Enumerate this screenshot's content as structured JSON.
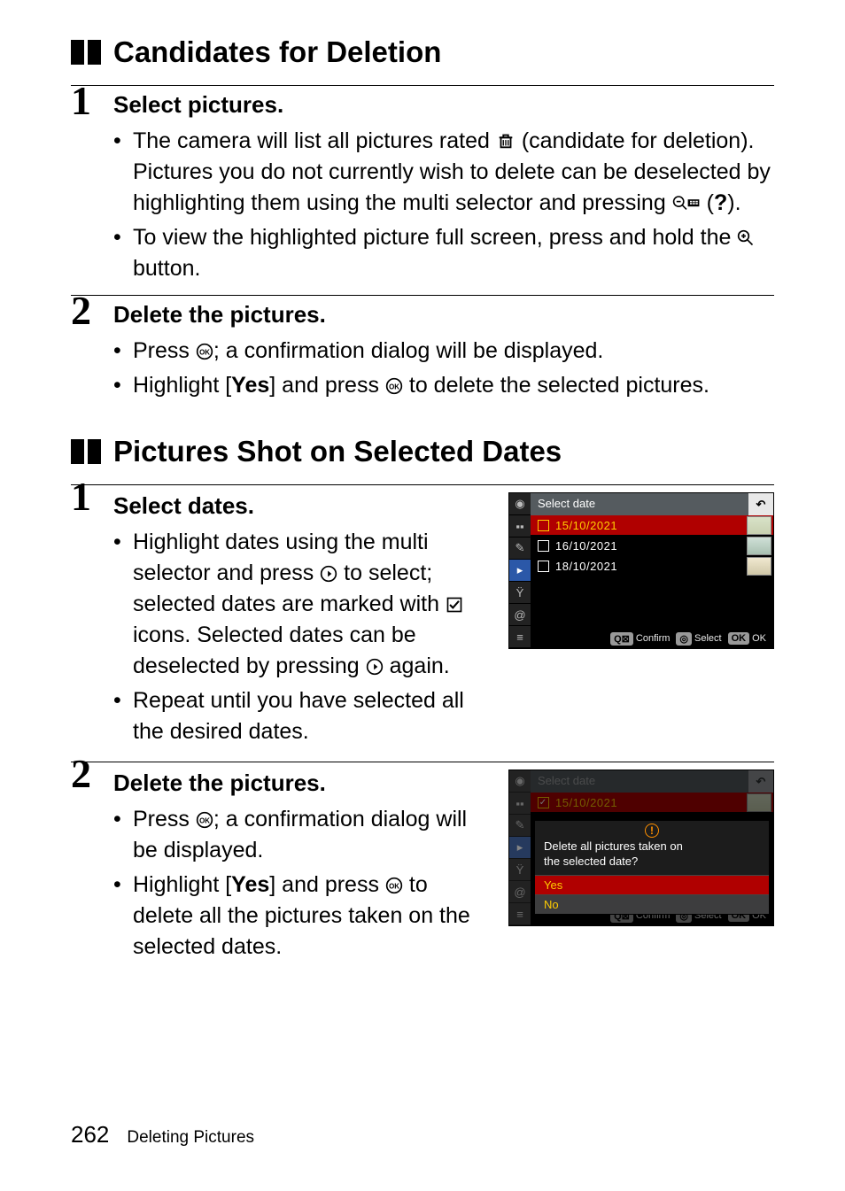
{
  "sectionA": {
    "title": "Candidates for Deletion",
    "steps": [
      {
        "num": "1",
        "title": "Select pictures.",
        "bullets": [
          {
            "parts": [
              "The camera will list all pictures rated ",
              {
                "icon": "trash-candidate"
              },
              " (candidate for deletion). Pictures you do not currently wish to delete can be deselected by highlighting them using the multi selector and pressing ",
              {
                "icon": "qminus"
              },
              " (",
              {
                "bold": "?"
              },
              ")."
            ]
          },
          {
            "parts": [
              "To view the highlighted picture full screen, press and hold the ",
              {
                "icon": "qplus"
              },
              " button."
            ]
          }
        ]
      },
      {
        "num": "2",
        "title": "Delete the pictures.",
        "bullets": [
          {
            "parts": [
              "Press ",
              {
                "icon": "ok"
              },
              "; a confirmation dialog will be displayed."
            ]
          },
          {
            "parts": [
              "Highlight [",
              {
                "bold": "Yes"
              },
              "] and press ",
              {
                "icon": "ok"
              },
              " to delete the selected pictures."
            ]
          }
        ]
      }
    ]
  },
  "sectionB": {
    "title": "Pictures Shot on Selected Dates",
    "steps": [
      {
        "num": "1",
        "title": "Select dates.",
        "bullets": [
          {
            "parts": [
              "Highlight dates using the multi selector and press ",
              {
                "icon": "right"
              },
              " to select; selected dates are marked with ",
              {
                "icon": "checkbox"
              },
              " icons. Selected dates can be deselected by pressing ",
              {
                "icon": "right"
              },
              " again."
            ]
          },
          {
            "parts": [
              "Repeat until you have selected all the desired dates."
            ]
          }
        ],
        "screen": {
          "title": "Select date",
          "rows": [
            {
              "checked": false,
              "date": "15/10/2021",
              "highlight": true,
              "yellow": true
            },
            {
              "checked": false,
              "date": "16/10/2021",
              "highlight": false,
              "yellow": false
            },
            {
              "checked": false,
              "date": "18/10/2021",
              "highlight": false,
              "yellow": false
            }
          ],
          "footer": [
            {
              "tag": "Q",
              "label": "Confirm"
            },
            {
              "tag": "◎",
              "label": "Select"
            },
            {
              "tag": "OK",
              "label": "OK"
            }
          ]
        }
      },
      {
        "num": "2",
        "title": "Delete the pictures.",
        "bullets": [
          {
            "parts": [
              "Press ",
              {
                "icon": "ok"
              },
              "; a confirmation dialog will be displayed."
            ]
          },
          {
            "parts": [
              "Highlight [",
              {
                "bold": "Yes"
              },
              "] and press ",
              {
                "icon": "ok"
              },
              " to delete all the pictures taken on the selected dates."
            ]
          }
        ],
        "screen": {
          "title": "Select date",
          "rows": [
            {
              "checked": true,
              "date": "15/10/2021",
              "highlight": true,
              "yellow": true
            }
          ],
          "dialog": {
            "icon": "!",
            "message_line1": "Delete all pictures taken on",
            "message_line2": "the selected date?",
            "opts": [
              "Yes",
              "No"
            ],
            "selected": 0
          },
          "footer": [
            {
              "tag": "Q",
              "label": "Confirm"
            },
            {
              "tag": "◎",
              "label": "Select"
            },
            {
              "tag": "OK",
              "label": "OK"
            }
          ]
        }
      }
    ]
  },
  "footer": {
    "page": "262",
    "title": "Deleting Pictures"
  }
}
